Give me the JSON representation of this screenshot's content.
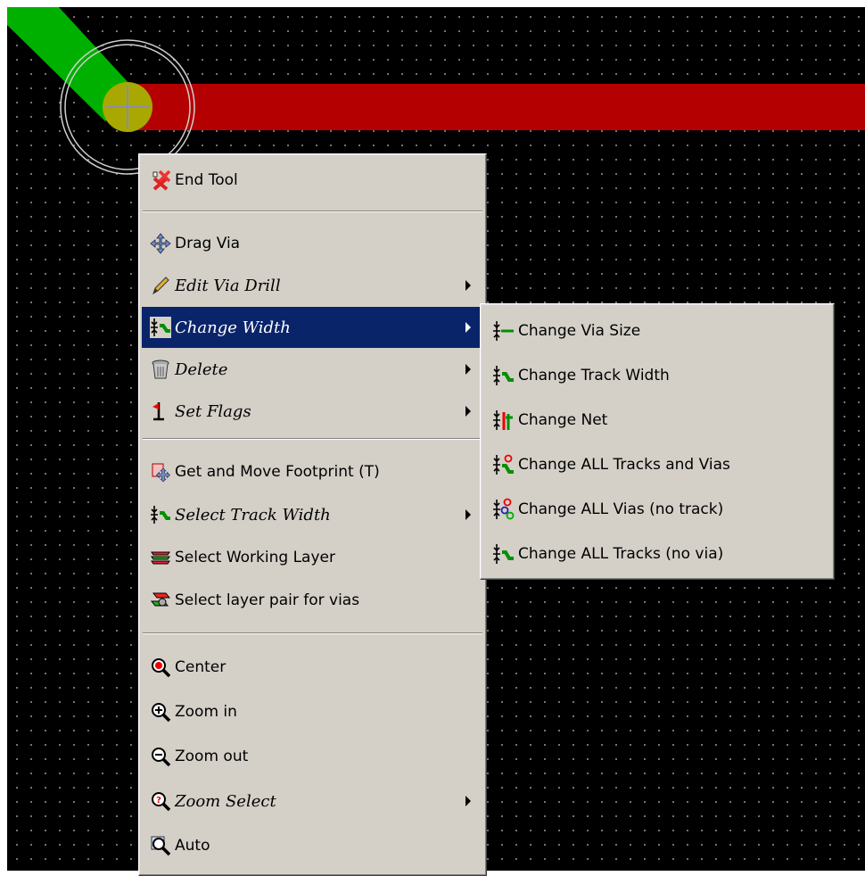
{
  "board": {
    "colors": {
      "background": "#000000",
      "grid_dots": "#8a8a8a",
      "track_red": "#b40000",
      "track_green": "#00b000",
      "via": "#a8a800"
    }
  },
  "main_menu": {
    "items": [
      {
        "label": "End Tool",
        "icon": "end-tool-icon"
      },
      {
        "label": "Drag Via",
        "icon": "move-arrows-icon"
      },
      {
        "label": "Edit Via Drill",
        "icon": "pencil-icon",
        "submenu": true
      },
      {
        "label": "Change Width",
        "icon": "track-width-icon",
        "submenu": true,
        "highlighted": true
      },
      {
        "label": "Delete",
        "icon": "trash-can-icon",
        "submenu": true
      },
      {
        "label": "Set Flags",
        "icon": "red-flag-icon",
        "submenu": true
      },
      {
        "label": "Get and Move Footprint (T)",
        "icon": "footprint-move-icon"
      },
      {
        "label": "Select Track Width",
        "icon": "track-width-icon",
        "submenu": true
      },
      {
        "label": "Select Working Layer",
        "icon": "layers-icon"
      },
      {
        "label": "Select layer pair for vias",
        "icon": "layer-pair-icon"
      },
      {
        "label": "Center",
        "icon": "zoom-center-icon"
      },
      {
        "label": "Zoom in",
        "icon": "zoom-in-icon"
      },
      {
        "label": "Zoom out",
        "icon": "zoom-out-icon"
      },
      {
        "label": "Zoom Select",
        "icon": "zoom-select-icon",
        "submenu": true
      },
      {
        "label": "Auto",
        "icon": "zoom-auto-icon"
      }
    ]
  },
  "sub_menu": {
    "items": [
      {
        "label": "Change Via Size",
        "icon": "via-size-icon"
      },
      {
        "label": "Change Track Width",
        "icon": "track-width-icon"
      },
      {
        "label": "Change Net",
        "icon": "change-net-icon"
      },
      {
        "label": "Change ALL Tracks and Vias",
        "icon": "all-tracks-vias-icon"
      },
      {
        "label": "Change ALL Vias (no track)",
        "icon": "all-vias-icon"
      },
      {
        "label": "Change ALL Tracks (no via)",
        "icon": "all-tracks-icon"
      }
    ]
  }
}
